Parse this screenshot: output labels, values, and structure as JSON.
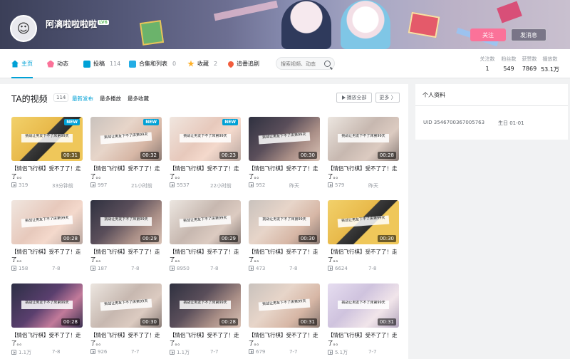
{
  "user": {
    "name": "阿漓啦啦啦啦",
    "level": "LV6",
    "follow_label": "关注",
    "message_label": "发消息"
  },
  "nav": {
    "tabs": [
      {
        "label": "主页",
        "count": "",
        "icon": "home-icon",
        "color": "#00a1d6"
      },
      {
        "label": "动态",
        "count": "",
        "icon": "dynamic-icon",
        "color": "#fb7299"
      },
      {
        "label": "投稿",
        "count": "114",
        "icon": "upload-icon",
        "color": "#00a1d6"
      },
      {
        "label": "合集和列表",
        "count": "0",
        "icon": "collection-icon",
        "color": "#23ade5"
      },
      {
        "label": "收藏",
        "count": "2",
        "icon": "star-icon",
        "color": "#ffb027"
      },
      {
        "label": "追番追剧",
        "count": "",
        "icon": "heart-icon",
        "color": "#f25d3d"
      }
    ],
    "search_placeholder": "搜索视频、动态"
  },
  "stats": [
    {
      "label": "关注数",
      "value": "1"
    },
    {
      "label": "粉丝数",
      "value": "549"
    },
    {
      "label": "获赞数",
      "value": "7869"
    },
    {
      "label": "播放数",
      "value": "53.1万"
    }
  ],
  "videos_section": {
    "title": "TA的视频",
    "count": "114",
    "sorts": [
      "最新发布",
      "最多播放",
      "最多收藏"
    ],
    "play_all_label": "播放全部",
    "more_label": "更多 〉"
  },
  "videos": [
    {
      "title": "【情侣飞行棋】受不了了！走了。。",
      "views": "319",
      "date": "33分钟前",
      "duration": "00:31",
      "new": "NEW",
      "caption": "挑战让男友下不了床第99天"
    },
    {
      "title": "【情侣飞行棋】受不了了！走了。。",
      "views": "997",
      "date": "21小时前",
      "duration": "00:32",
      "new": "NEW",
      "caption": "挑战让男友下不了床第99天"
    },
    {
      "title": "【情侣飞行棋】受不了了！走了。。",
      "views": "5537",
      "date": "22小时前",
      "duration": "00:23",
      "new": "NEW",
      "caption": "挑战让男友下不了床第99天"
    },
    {
      "title": "【情侣飞行棋】受不了了！走了。。",
      "views": "952",
      "date": "昨天",
      "duration": "00:30",
      "new": "",
      "caption": "挑战让男友下不了床第99天"
    },
    {
      "title": "【情侣飞行棋】受不了了！走了。。",
      "views": "579",
      "date": "昨天",
      "duration": "00:28",
      "new": "",
      "caption": "挑战让男友下不了床第99天"
    },
    {
      "title": "【情侣飞行棋】受不了了！走了。。",
      "views": "158",
      "date": "7-8",
      "duration": "00:28",
      "new": "",
      "caption": "挑战让男友下不了床第99天"
    },
    {
      "title": "【情侣飞行棋】受不了了！走了。。",
      "views": "187",
      "date": "7-8",
      "duration": "00:29",
      "new": "",
      "caption": "挑战让男友下不了床第99天"
    },
    {
      "title": "【情侣飞行棋】受不了了！走了。。",
      "views": "8950",
      "date": "7-8",
      "duration": "00:29",
      "new": "",
      "caption": "挑战让男友下不了床第99天"
    },
    {
      "title": "【情侣飞行棋】受不了了！走了。。",
      "views": "473",
      "date": "7-8",
      "duration": "00:30",
      "new": "",
      "caption": "挑战让男友下不了床第99天"
    },
    {
      "title": "【情侣飞行棋】受不了了！走了。。",
      "views": "6624",
      "date": "7-8",
      "duration": "00:30",
      "new": "",
      "caption": "挑战让男友下不了床第99天"
    },
    {
      "title": "【情侣飞行棋】受不了了！走了。。",
      "views": "1.1万",
      "date": "7-8",
      "duration": "00:28",
      "new": "",
      "caption": "挑战让男友下不了床第99天"
    },
    {
      "title": "【情侣飞行棋】受不了了！走了。。",
      "views": "926",
      "date": "7-7",
      "duration": "00:30",
      "new": "",
      "caption": "挑战让男友下不了床第99天"
    },
    {
      "title": "【情侣飞行棋】受不了了！走了。。",
      "views": "1.1万",
      "date": "7-7",
      "duration": "00:28",
      "new": "",
      "caption": "挑战让男友下不了床第99天"
    },
    {
      "title": "【情侣飞行棋】受不了了！走了。。",
      "views": "679",
      "date": "7-7",
      "duration": "00:31",
      "new": "",
      "caption": "挑战让男友下不了床第99天"
    },
    {
      "title": "【情侣飞行棋】受不了了！走了。。",
      "views": "5.1万",
      "date": "7-7",
      "duration": "00:31",
      "new": "",
      "caption": "挑战让男友下不了床第99天"
    }
  ],
  "profile": {
    "heading": "个人资料",
    "uid": "UID 3546700367005763",
    "birthday": "生日 01-01"
  }
}
